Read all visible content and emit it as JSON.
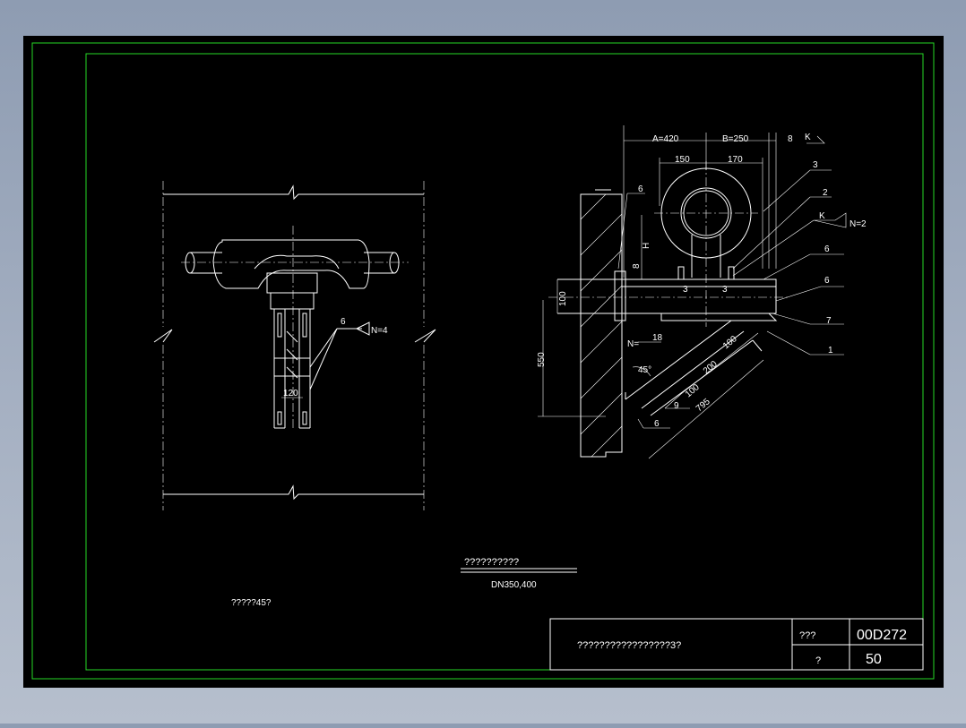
{
  "colors": {
    "canvas": "#000000",
    "border": "#26d926",
    "lines": "#ffffff"
  },
  "left_view": {
    "weld_size": "6",
    "weld_count": "N=4",
    "dim_spacing": "120",
    "caption": "?????45?"
  },
  "right_view": {
    "dim_a": "A=420",
    "dim_b": "B=250",
    "dim_8": "8",
    "dim_150": "150",
    "dim_170": "170",
    "weld_k": "K",
    "weld_n2": "N=2",
    "callouts": [
      "3",
      "2",
      "6",
      "7",
      "1",
      "9"
    ],
    "weld_6a": "6",
    "weld_6b": "6",
    "weld_6c": "6",
    "weld_n": "N=",
    "weld_18": "18",
    "dim_h": "H",
    "dim_8v": "8",
    "dim_100": "100",
    "dim_550": "550",
    "dim_3a": "3",
    "dim_3b": "3",
    "dim_100d": "100",
    "dim_200d": "200",
    "dim_100s": "100",
    "dim_795": "795",
    "angle": "45°",
    "weld_6d": "6",
    "weld_4": "4"
  },
  "subtitle": {
    "title": "??????????",
    "spec": "DN350,400"
  },
  "title_block": {
    "drawing_title": "?????????????????3?",
    "label_top": "???",
    "value_top": "00D272",
    "label_bottom": "?",
    "value_bottom": "50"
  }
}
